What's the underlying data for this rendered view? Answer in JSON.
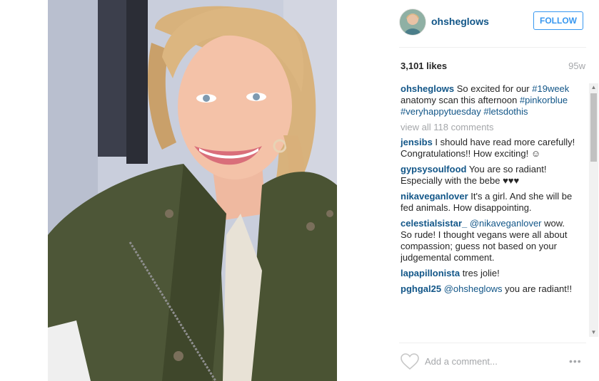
{
  "post": {
    "username": "ohsheglows",
    "follow_label": "FOLLOW",
    "likes": "3,101 likes",
    "time": "95w",
    "caption": {
      "username": "ohsheglows",
      "parts": [
        {
          "text": " So excited for our ",
          "tag": false
        },
        {
          "text": "#19week",
          "tag": true
        },
        {
          "text": " anatomy scan this afternoon ",
          "tag": false
        },
        {
          "text": "#pinkorblue",
          "tag": true
        },
        {
          "text": " ",
          "tag": false
        },
        {
          "text": "#veryhappytuesday",
          "tag": true
        },
        {
          "text": " ",
          "tag": false
        },
        {
          "text": "#letsdothis",
          "tag": true
        }
      ]
    },
    "view_all": "view all 118 comments",
    "comments": [
      {
        "user": "jensibs",
        "parts": [
          {
            "text": " I should have read more carefully! Congratulations!! How exciting! ☺",
            "tag": false
          }
        ]
      },
      {
        "user": "gypsysoulfood",
        "parts": [
          {
            "text": " You are so radiant! Especially with the bebe ♥♥♥",
            "tag": false
          }
        ]
      },
      {
        "user": "nikaveganlover",
        "parts": [
          {
            "text": " It's a girl. And she will be fed animals. How disappointing.",
            "tag": false
          }
        ]
      },
      {
        "user": "celestialsistar_",
        "parts": [
          {
            "text": " ",
            "tag": false
          },
          {
            "text": "@nikaveganlover",
            "tag": true
          },
          {
            "text": " wow. So rude! I thought vegans were all about compassion; guess not based on your judgemental comment.",
            "tag": false
          }
        ]
      },
      {
        "user": "lapapillonista",
        "parts": [
          {
            "text": " tres jolie!",
            "tag": false
          }
        ]
      },
      {
        "user": "pghgal25",
        "parts": [
          {
            "text": " ",
            "tag": false
          },
          {
            "text": "@ohsheglows",
            "tag": true
          },
          {
            "text": " you are radiant!!",
            "tag": false
          }
        ]
      }
    ],
    "add_comment_placeholder": "Add a comment...",
    "more_label": "•••"
  },
  "icons": {
    "heart": "heart-icon",
    "more": "more-options-icon",
    "scroll_up": "scroll-up-arrow-icon",
    "scroll_down": "scroll-down-arrow-icon"
  },
  "colors": {
    "link": "#125688",
    "follow": "#3897f0",
    "muted": "#a5a7aa",
    "text": "#262626"
  }
}
